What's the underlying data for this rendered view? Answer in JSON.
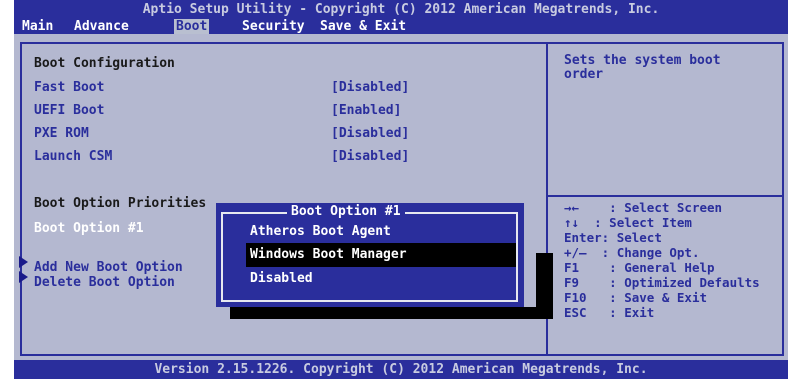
{
  "header": {
    "title": "Aptio Setup Utility - Copyright (C) 2012 American Megatrends, Inc.",
    "tabs": [
      {
        "label": "Main"
      },
      {
        "label": "Advance"
      },
      {
        "label": "Boot"
      },
      {
        "label": "Security"
      },
      {
        "label": "Save & Exit"
      }
    ],
    "active_tab": "Boot"
  },
  "left_panel": {
    "boot_configuration": "Boot Configuration",
    "items": [
      {
        "label": "Fast Boot",
        "value": "[Disabled]"
      },
      {
        "label": "UEFI Boot",
        "value": "[Enabled]"
      },
      {
        "label": "PXE ROM",
        "value": "[Disabled]"
      },
      {
        "label": "Launch CSM",
        "value": "[Disabled]"
      }
    ],
    "boot_option_priorities": "Boot Option Priorities",
    "boot_option_1": "Boot Option #1",
    "add_new_boot_option": "Add New Boot Option",
    "delete_boot_option": "Delete Boot Option"
  },
  "popup": {
    "title": "Boot Option #1",
    "options": [
      "Atheros Boot Agent",
      "Windows Boot Manager",
      "Disabled"
    ],
    "selected": "Windows Boot Manager"
  },
  "help_panel": {
    "description": "Sets the system boot\norder",
    "keys": [
      {
        "key": "→←",
        "desc": ": Select Screen"
      },
      {
        "key": "↑↓",
        "desc": ": Select Item"
      },
      {
        "key": "Enter:",
        "desc": "Select"
      },
      {
        "key": "+/—",
        "desc": ": Change Opt."
      },
      {
        "key": "F1",
        "desc": ": General Help"
      },
      {
        "key": "F9",
        "desc": ": Optimized Defaults"
      },
      {
        "key": "F10",
        "desc": ": Save & Exit"
      },
      {
        "key": "ESC",
        "desc": ": Exit"
      }
    ]
  },
  "footer": {
    "version": "Version 2.15.1226. Copyright (C) 2012 American Megatrends, Inc."
  },
  "colors": {
    "header_blue": "#2a2e9c",
    "panel_gray": "#b4b8d0",
    "selected_text": "#ffffff",
    "highlight": "#000000"
  }
}
